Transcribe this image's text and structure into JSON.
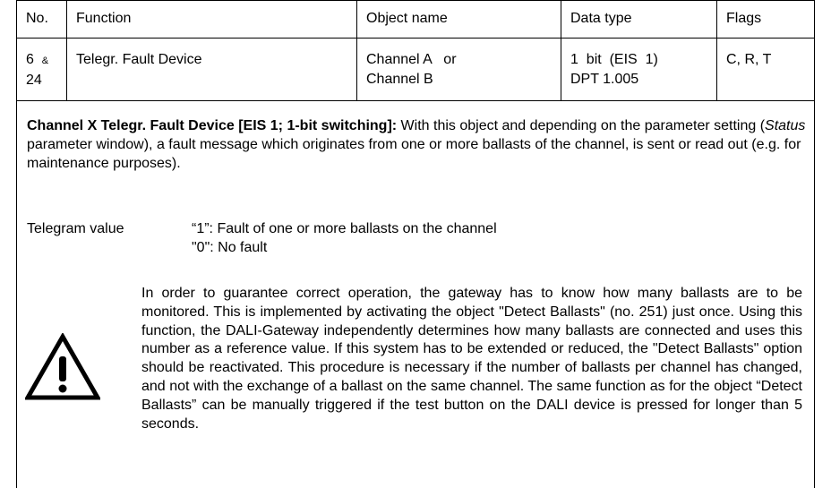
{
  "table": {
    "headers": [
      "No.",
      "Function",
      "Object name",
      "Data type",
      "Flags"
    ],
    "row": {
      "no_line1": "6",
      "no_amp": "&",
      "no_line2": "24",
      "function": "Telegr. Fault Device",
      "object_line1": "Channel A   or",
      "object_line2": "Channel B",
      "datatype_line1": "1  bit  (EIS  1)",
      "datatype_line2": "DPT 1.005",
      "flags": "C, R, T"
    }
  },
  "description": {
    "bold": "Channel X Telegr. Fault Device [EIS 1; 1-bit switching]:",
    "text_a": " With this object and depending on the parameter setting (",
    "italic": "Status",
    "text_b": " parameter window), a fault message which originates from one or more ballasts of the channel, is sent or read out (e.g. for maintenance purposes)."
  },
  "telegram": {
    "label": "Telegram value",
    "value_1": "“1”: Fault of one or more ballasts on the channel",
    "value_0": "\"0\": No fault"
  },
  "warning": {
    "icon": "warning-triangle-icon",
    "text": "In order to guarantee correct operation, the gateway has to know how many ballasts are to be monitored. This is implemented by activating the object \"Detect Ballasts\" (no. 251) just once. Using this function, the DALI-Gateway independently determines how many ballasts are connected and uses this number as a reference value. If this system has to be extended or reduced, the \"Detect Ballasts\" option should be reactivated. This procedure is necessary if the number of ballasts per channel has changed, and not with the exchange of a ballast on the same channel. The same function as for the object “Detect Ballasts” can be manually triggered if the test button on the DALI device is pressed for longer than 5 seconds."
  }
}
